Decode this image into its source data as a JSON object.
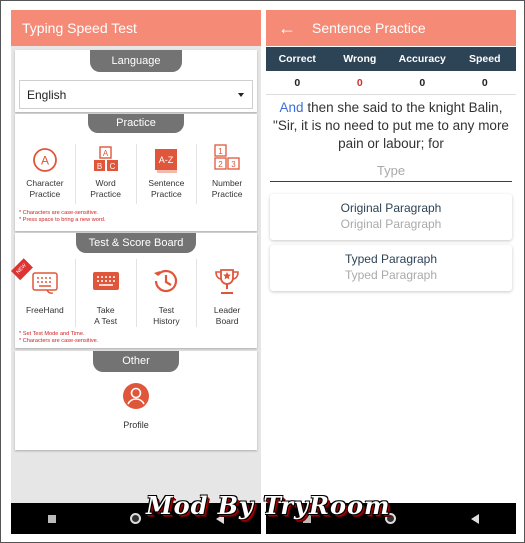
{
  "left": {
    "title": "Typing Speed Test",
    "language": {
      "header": "Language",
      "selected": "English"
    },
    "practice": {
      "header": "Practice",
      "items": [
        {
          "line1": "Character",
          "line2": "Practice"
        },
        {
          "line1": "Word",
          "line2": "Practice"
        },
        {
          "line1": "Sentence",
          "line2": "Practice"
        },
        {
          "line1": "Number",
          "line2": "Practice"
        }
      ],
      "notes": [
        "* Characters are case-sensitive.",
        "* Press space to bring a new word."
      ]
    },
    "test": {
      "header": "Test & Score Board",
      "items": [
        {
          "line1": "FreeHand",
          "line2": "",
          "badge": "NEW"
        },
        {
          "line1": "Take",
          "line2": "A Test"
        },
        {
          "line1": "Test",
          "line2": "History"
        },
        {
          "line1": "Leader",
          "line2": "Board"
        }
      ],
      "notes": [
        "* Set Test Mode and Time.",
        "* Characters are case-sensitive."
      ]
    },
    "other": {
      "header": "Other",
      "profile_label": "Profile"
    }
  },
  "right": {
    "title": "Sentence Practice",
    "stats": {
      "headers": [
        "Correct",
        "Wrong",
        "Accuracy",
        "Speed"
      ],
      "values": [
        "0",
        "0",
        "0",
        "0"
      ],
      "wrong_color": "#d32f2f"
    },
    "sentence": {
      "highlight": "And",
      "rest": " then she said to the knight Balin, \"Sir, it is no need to put me to any more pain or labour; for"
    },
    "input": {
      "placeholder": "Type"
    },
    "original": {
      "title": "Original Paragraph",
      "content": "Original Paragraph"
    },
    "typed": {
      "title": "Typed Paragraph",
      "content": "Typed Paragraph"
    }
  },
  "watermark": "Mod By TryRoom",
  "colors": {
    "accent": "#f58a76",
    "navy": "#2d4356",
    "section_tab": "#737373",
    "icon": "#e0563b"
  }
}
